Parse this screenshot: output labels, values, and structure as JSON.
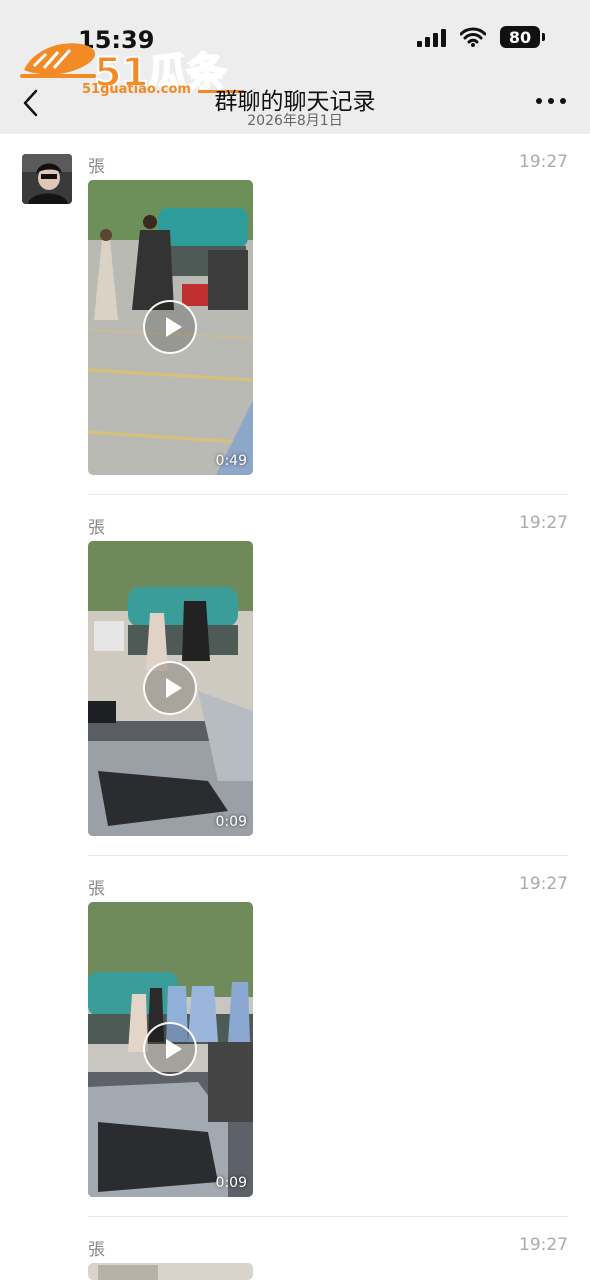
{
  "status_bar": {
    "time": "15:39",
    "battery": "80",
    "signal_icon": "cellular-signal-icon",
    "wifi_icon": "wifi-icon"
  },
  "watermark": {
    "brand": "51瓜条",
    "url": "51guatiao.com"
  },
  "nav": {
    "title": "群聊的聊天记录",
    "subtitle": "2026年8月1日",
    "back_icon": "chevron-left-icon",
    "more_icon": "more-dots-icon"
  },
  "messages": [
    {
      "sender": "張",
      "time": "19:27",
      "duration": "0:49"
    },
    {
      "sender": "張",
      "time": "19:27",
      "duration": "0:09"
    },
    {
      "sender": "張",
      "time": "19:27",
      "duration": "0:09"
    },
    {
      "sender": "張",
      "time": "19:27"
    }
  ],
  "colors": {
    "header_bg": "#ededed",
    "watermark_orange": "#f28a26"
  }
}
